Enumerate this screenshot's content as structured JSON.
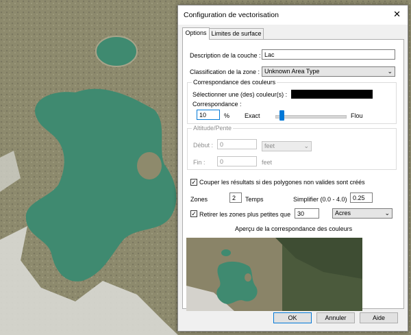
{
  "window": {
    "title": "Configuration de vectorisation",
    "close_glyph": "✕"
  },
  "tabs": [
    {
      "label": "Options",
      "active": true
    },
    {
      "label": "Limites de surface",
      "active": false
    }
  ],
  "options": {
    "layer_description": {
      "label": "Description de la couche :",
      "value": "Lac"
    },
    "zone_classification": {
      "label": "Classification de la zone :",
      "value": "Unknown Area Type"
    },
    "color_match_group": {
      "title": "Correspondance des couleurs",
      "select_colors_label": "Sélectionner une (des) couleur(s) :",
      "selected_color": "#000000",
      "correspondence_label": "Correspondance :",
      "tolerance_value": "10",
      "percent_unit": "%",
      "exact_label": "Exact",
      "fuzzy_label": "Flou",
      "slider_level": 0.1
    },
    "altitude_group": {
      "title": "Altitude/Pente",
      "start_label": "Début :",
      "start_value": "0",
      "start_unit": "feet",
      "end_label": "Fin :",
      "end_value": "0",
      "end_unit": "feet"
    },
    "clip_invalid": {
      "label": "Couper les résultats si des polygones non valides sont créés",
      "checked": true
    },
    "zones": {
      "label": "Zones",
      "value": "2",
      "suffix": "Temps"
    },
    "simplify": {
      "label": "Simplifier (0.0 - 4.0)",
      "value": "0.25"
    },
    "remove_small": {
      "label": "Retirer les zones plus petites que",
      "checked": true,
      "value": "30",
      "unit": "Acres"
    },
    "preview_title": "Aperçu de la correspondance des couleurs"
  },
  "buttons": {
    "ok": "OK",
    "cancel": "Annuler",
    "help": "Aide"
  },
  "icons": {
    "dropdown": "chevron-down-icon",
    "checkmark": "✓"
  },
  "colors": {
    "accent": "#0078d7",
    "lake": "#3f8a70",
    "terrain": "#8e8a6c"
  }
}
